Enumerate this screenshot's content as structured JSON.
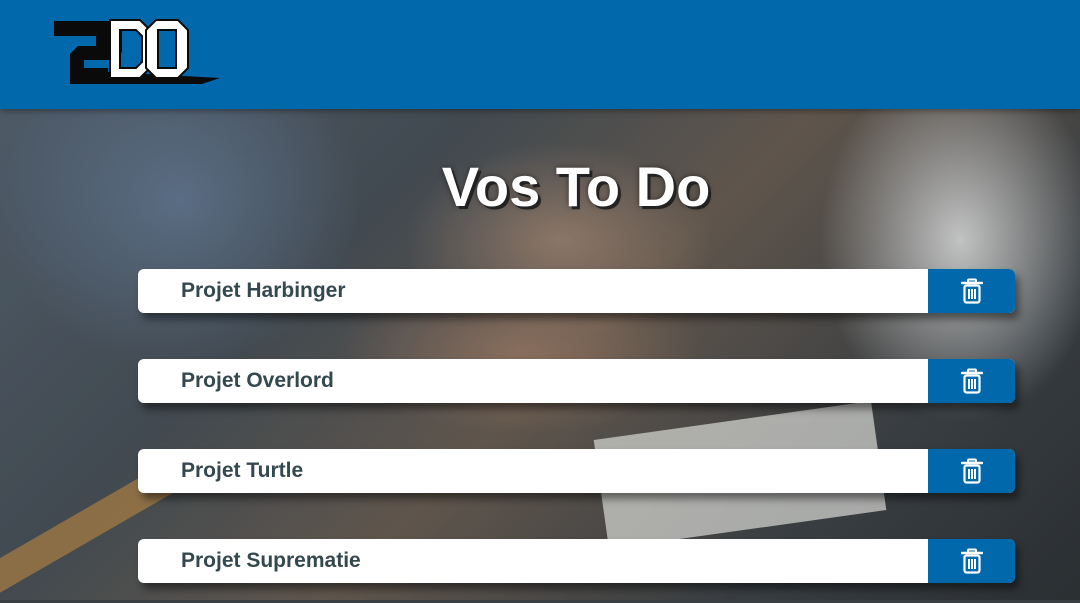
{
  "logo": {
    "text": "2DO",
    "icon": "2do-logo"
  },
  "page_title": "Vos To Do",
  "todos": [
    {
      "label": "Projet Harbinger",
      "delete_icon": "trash-icon"
    },
    {
      "label": "Projet Overlord",
      "delete_icon": "trash-icon"
    },
    {
      "label": "Projet Turtle",
      "delete_icon": "trash-icon"
    },
    {
      "label": "Projet Suprematie",
      "delete_icon": "trash-icon"
    }
  ],
  "colors": {
    "header": "#0068ab",
    "button": "#0068ab",
    "label": "#34494f",
    "item_bg": "#ffffff"
  }
}
